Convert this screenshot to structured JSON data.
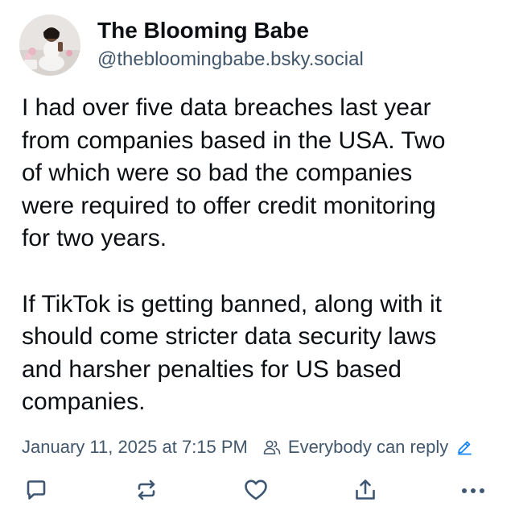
{
  "post": {
    "author": {
      "display_name": "The Blooming Babe",
      "handle": "@thebloomingbabe.bsky.social"
    },
    "body": [
      "I had over five data breaches last year",
      "from companies based in the USA. Two",
      "of which were so bad the companies",
      "were required to offer credit monitoring",
      "for two years.",
      "If TikTok is getting banned, along with it",
      "should come stricter data security laws",
      "and harsher penalties for US based",
      "companies."
    ],
    "timestamp": "January 11, 2025 at 7:15 PM",
    "reply_setting": "Everybody can reply"
  },
  "icons": {
    "people": "people-icon",
    "edit": "pencil-icon",
    "reply": "reply-icon",
    "repost": "repost-icon",
    "like": "heart-icon",
    "share": "share-icon",
    "more": "more-icon"
  },
  "colors": {
    "text": "#0b0f14",
    "muted": "#42576c",
    "accent": "#1083fe",
    "icon": "#3d5672"
  }
}
